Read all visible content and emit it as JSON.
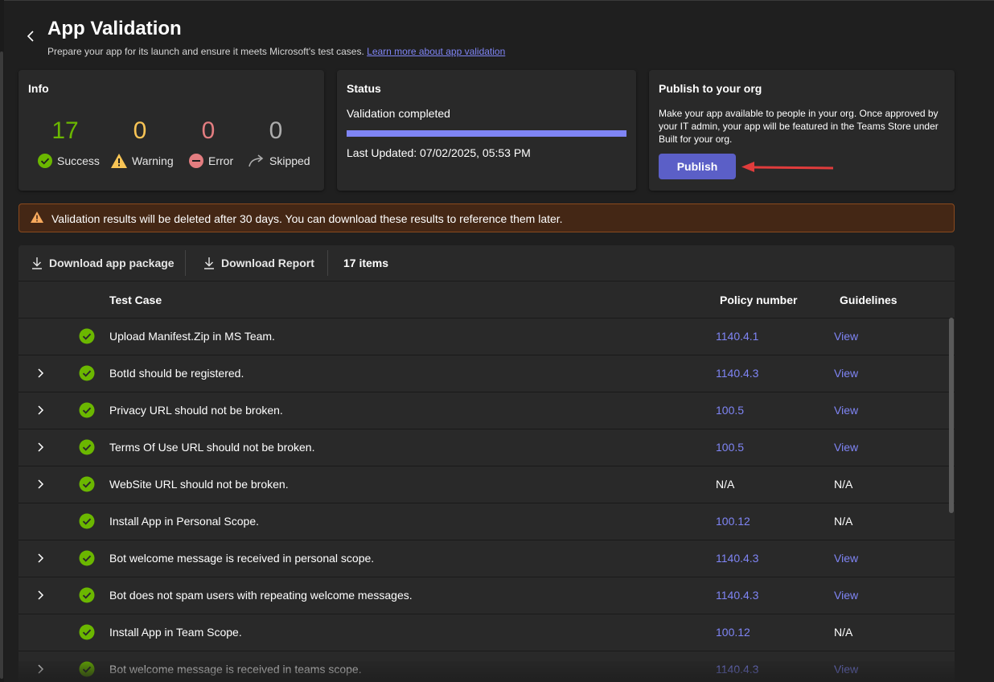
{
  "header": {
    "title": "App Validation",
    "subtitle": "Prepare your app for its launch and ensure it meets Microsoft's test cases.",
    "learn_more": "Learn more about app validation"
  },
  "info": {
    "title": "Info",
    "stats": [
      {
        "value": "17",
        "label": "Success",
        "color": "#6bb700",
        "icon": "check-circle-icon"
      },
      {
        "value": "0",
        "label": "Warning",
        "color": "#f8c455",
        "icon": "warning-icon"
      },
      {
        "value": "0",
        "label": "Error",
        "color": "#e37d80",
        "icon": "error-icon"
      },
      {
        "value": "0",
        "label": "Skipped",
        "color": "#adadad",
        "icon": "skip-arrow-icon"
      }
    ]
  },
  "status": {
    "title": "Status",
    "state": "Validation completed",
    "progress": 1.0,
    "last_updated": "Last Updated: 07/02/2025, 05:53 PM"
  },
  "publish": {
    "title": "Publish to your org",
    "description": "Make your app available to people in your org. Once approved by your IT admin, your app will be featured in the Teams Store under Built for your org.",
    "button": "Publish"
  },
  "banner": {
    "text": "Validation results will be deleted after 30 days. You can download these results to reference them later."
  },
  "toolbar": {
    "download_package": "Download app package",
    "download_report": "Download Report",
    "count": "17 items"
  },
  "table": {
    "columns": {
      "test_case": "Test Case",
      "policy": "Policy number",
      "guidelines": "Guidelines"
    },
    "rows": [
      {
        "expandable": false,
        "test_case": "Upload Manifest.Zip in MS Team.",
        "policy": "1140.4.1",
        "guidelines": "View"
      },
      {
        "expandable": true,
        "test_case": "BotId should be registered.",
        "policy": "1140.4.3",
        "guidelines": "View"
      },
      {
        "expandable": true,
        "test_case": "Privacy URL should not be broken.",
        "policy": "100.5",
        "guidelines": "View"
      },
      {
        "expandable": true,
        "test_case": "Terms Of Use URL should not be broken.",
        "policy": "100.5",
        "guidelines": "View"
      },
      {
        "expandable": true,
        "test_case": "WebSite URL should not be broken.",
        "policy": "N/A",
        "guidelines": "N/A"
      },
      {
        "expandable": false,
        "test_case": "Install App in Personal Scope.",
        "policy": "100.12",
        "guidelines": "N/A"
      },
      {
        "expandable": true,
        "test_case": "Bot welcome message is received in personal scope.",
        "policy": "1140.4.3",
        "guidelines": "View"
      },
      {
        "expandable": true,
        "test_case": "Bot does not spam users with repeating welcome messages.",
        "policy": "1140.4.3",
        "guidelines": "View"
      },
      {
        "expandable": false,
        "test_case": "Install App in Team Scope.",
        "policy": "100.12",
        "guidelines": "N/A"
      },
      {
        "expandable": true,
        "test_case": "Bot welcome message is received in teams scope.",
        "policy": "1140.4.3",
        "guidelines": "View"
      }
    ]
  },
  "colors": {
    "accent": "#5b5fc7",
    "link": "#7f85f5",
    "success": "#6bb700",
    "banner_bg": "#442715"
  }
}
